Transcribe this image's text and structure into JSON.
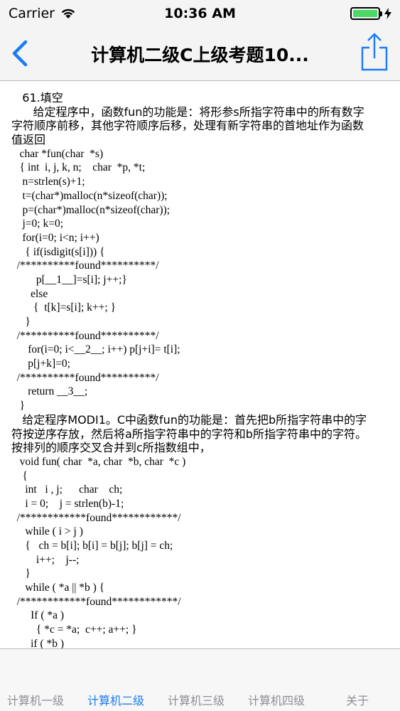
{
  "status_bar": {
    "carrier": "Carrier",
    "time": "10:36 AM",
    "battery_level": 1.0
  },
  "nav": {
    "title": "计算机二级C上级考题10...",
    "back_icon": "chevron-left-icon",
    "share_icon": "share-icon",
    "accent_color": "#1a7cf4"
  },
  "content": {
    "lines": [
      "   61.填空",
      "      给定程序中，函数fun的功能是：将形参s所指字符串中的所有数字",
      "字符顺序前移，其他字符顺序后移，处理有新字符串的首地址作为函数",
      "值返回",
      "   char *fun(char  *s)",
      "   { int  i, j, k, n;    char  *p, *t;",
      "    n=strlen(s)+1;",
      "    t=(char*)malloc(n*sizeof(char));",
      "    p=(char*)malloc(n*sizeof(char));",
      "    j=0; k=0;",
      "    for(i=0; i<n; i++)",
      "     { if(isdigit(s[i])) {",
      "  /**********found**********/",
      "         p[__1__]=s[i]; j++;}",
      "       else",
      "        {  t[k]=s[i]; k++; }",
      "     }",
      "  /**********found**********/",
      "      for(i=0; i<__2__; i++) p[j+i]= t[i];",
      "      p[j+k]=0;",
      "  /**********found**********/",
      "      return __3__;",
      "   }",
      "   给定程序MODI1。C中函数fun的功能是：首先把b所指字符串中的字",
      "符按逆序存放，然后将a所指字符串中的字符和b所指字符串中的字符。",
      "按排列的顺序交叉合并到c所指数组中，",
      "   void fun( char  *a, char  *b, char  *c )",
      "    {",
      "     int   i , j;      char    ch;",
      "     i = 0;    j = strlen(b)-1;",
      "  /************found************/",
      "     while ( i > j )",
      "     {   ch = b[i]; b[i] = b[j]; b[j] = ch;",
      "         i++;    j--;",
      "     }",
      "     while ( *a || *b ) {",
      "  /************found************/",
      "       If ( *a )",
      "         { *c = *a;  c++; a++; }",
      "       if ( *b )"
    ]
  },
  "tabs": [
    {
      "label": "计算机一级",
      "active": false
    },
    {
      "label": "计算机二级",
      "active": true
    },
    {
      "label": "计算机三级",
      "active": false
    },
    {
      "label": "计算机四级",
      "active": false
    },
    {
      "label": "关于",
      "active": false
    }
  ]
}
